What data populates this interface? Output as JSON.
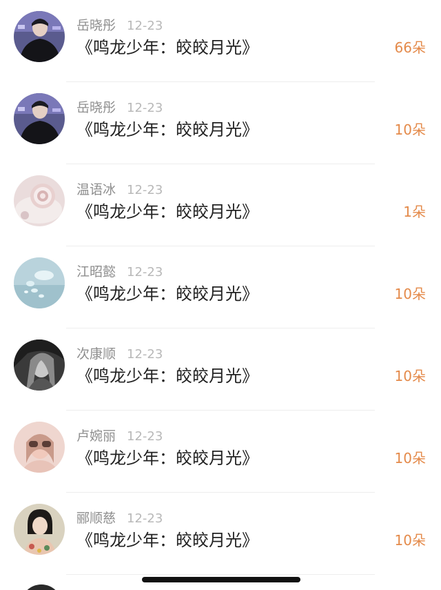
{
  "gifts": [
    {
      "name": "岳晓彤",
      "date": "12-23",
      "message": "《鸣龙少年：皎皎月光》",
      "amount": "66朵"
    },
    {
      "name": "岳晓彤",
      "date": "12-23",
      "message": "《鸣龙少年：皎皎月光》",
      "amount": "10朵"
    },
    {
      "name": "温语冰",
      "date": "12-23",
      "message": "《鸣龙少年：皎皎月光》",
      "amount": "1朵"
    },
    {
      "name": "江昭懿",
      "date": "12-23",
      "message": "《鸣龙少年：皎皎月光》",
      "amount": "10朵"
    },
    {
      "name": "次康顺",
      "date": "12-23",
      "message": "《鸣龙少年：皎皎月光》",
      "amount": "10朵"
    },
    {
      "name": "卢婉丽",
      "date": "12-23",
      "message": "《鸣龙少年：皎皎月光》",
      "amount": "10朵"
    },
    {
      "name": "郦顺慈",
      "date": "12-23",
      "message": "《鸣龙少年：皎皎月光》",
      "amount": "10朵"
    }
  ],
  "colors": {
    "name": "#8e8e8e",
    "date": "#b8b8b8",
    "message": "#222222",
    "amount": "#e48a4a",
    "divider": "#ededed"
  }
}
